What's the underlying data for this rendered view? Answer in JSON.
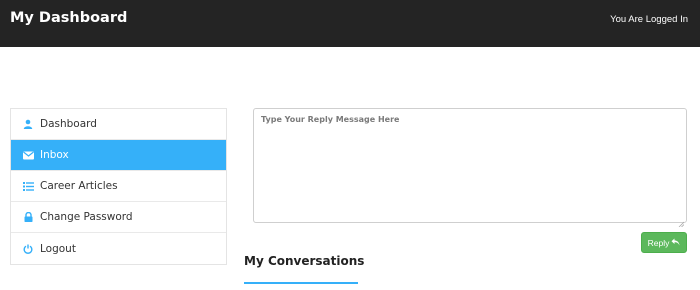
{
  "header": {
    "brand": "My Dashboard",
    "login_status": "You Are Logged In"
  },
  "sidebar": {
    "items": [
      {
        "label": "Dashboard",
        "icon": "user-icon",
        "active": false
      },
      {
        "label": "Inbox",
        "icon": "envelope-icon",
        "active": true
      },
      {
        "label": "Career Articles",
        "icon": "list-icon",
        "active": false
      },
      {
        "label": "Change Password",
        "icon": "lock-icon",
        "active": false
      },
      {
        "label": "Logout",
        "icon": "power-icon",
        "active": false
      }
    ]
  },
  "reply": {
    "placeholder": "Type Your Reply Message Here",
    "value": "",
    "button_label": "Reply",
    "button_icon": "reply-arrow-icon"
  },
  "conversations": {
    "heading": "My Conversations"
  },
  "colors": {
    "topbar": "#242424",
    "accent": "#35b0f9",
    "reply_button": "#5cb85c"
  }
}
